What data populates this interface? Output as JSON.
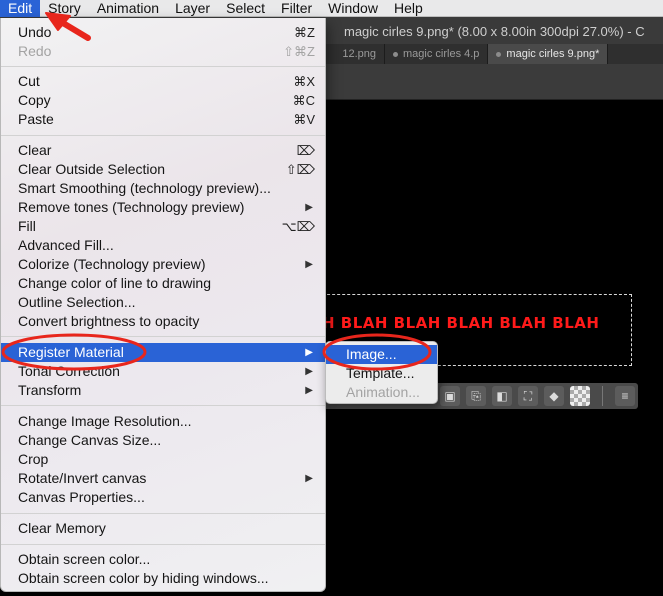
{
  "menubar": {
    "items": [
      "Edit",
      "Story",
      "Animation",
      "Layer",
      "Select",
      "Filter",
      "Window",
      "Help"
    ]
  },
  "document": {
    "title": "magic cirles 9.png* (8.00 x 8.00in 300dpi 27.0%) - C",
    "tabs": [
      "12.png",
      "magic cirles 4.p",
      "magic cirles 9.png*"
    ],
    "canvas_text": "H BLAH BLAH BLAH BLAH BLAH"
  },
  "edit_menu": {
    "undo": {
      "label": "Undo",
      "shortcut": "⌘Z"
    },
    "redo": {
      "label": "Redo",
      "shortcut": "⇧⌘Z"
    },
    "cut": {
      "label": "Cut",
      "shortcut": "⌘X"
    },
    "copy": {
      "label": "Copy",
      "shortcut": "⌘C"
    },
    "paste": {
      "label": "Paste",
      "shortcut": "⌘V"
    },
    "clear": {
      "label": "Clear",
      "shortcut": "⌦"
    },
    "clear_outside": {
      "label": "Clear Outside Selection",
      "shortcut": "⇧⌦"
    },
    "smart_smoothing": {
      "label": "Smart Smoothing (technology preview)..."
    },
    "remove_tones": {
      "label": "Remove tones (Technology preview)"
    },
    "fill": {
      "label": "Fill",
      "shortcut": "⌥⌦"
    },
    "advanced_fill": {
      "label": "Advanced Fill..."
    },
    "colorize": {
      "label": "Colorize (Technology preview)"
    },
    "change_color": {
      "label": "Change color of line to drawing"
    },
    "outline_selection": {
      "label": "Outline Selection..."
    },
    "convert_brightness": {
      "label": "Convert brightness to opacity"
    },
    "register_material": {
      "label": "Register Material"
    },
    "tonal_correction": {
      "label": "Tonal Correction"
    },
    "transform": {
      "label": "Transform"
    },
    "change_image_resolution": {
      "label": "Change Image Resolution..."
    },
    "change_canvas_size": {
      "label": "Change Canvas Size..."
    },
    "crop": {
      "label": "Crop"
    },
    "rotate_invert": {
      "label": "Rotate/Invert canvas"
    },
    "canvas_properties": {
      "label": "Canvas Properties..."
    },
    "clear_memory": {
      "label": "Clear Memory"
    },
    "obtain_color": {
      "label": "Obtain screen color..."
    },
    "obtain_color_hiding": {
      "label": "Obtain screen color by hiding windows..."
    }
  },
  "submenu": {
    "image": "Image...",
    "template": "Template...",
    "animation": "Animation..."
  },
  "colors": {
    "highlight": "#2a63d6",
    "annotation": "#e8261c",
    "canvas_text": "#ff1a1a"
  }
}
